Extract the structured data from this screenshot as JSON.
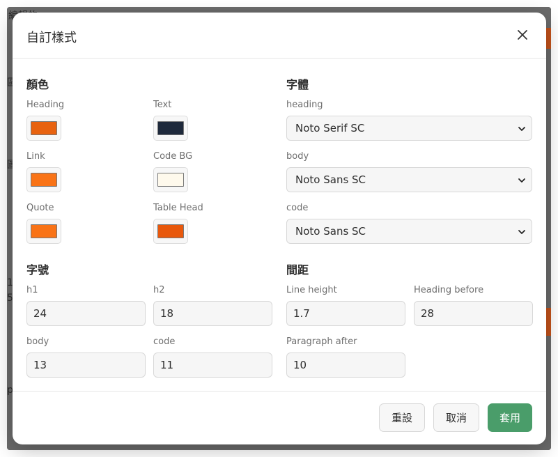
{
  "background": {
    "lines": [
      "編輯的",
      "區",
      "圖",
      "1",
      "5",
      "p"
    ]
  },
  "dialog": {
    "title": "自訂樣式",
    "close_icon": "close-icon"
  },
  "colors": {
    "title": "顏色",
    "fields": [
      {
        "label": "Heading",
        "color": "#E8620F"
      },
      {
        "label": "Text",
        "color": "#1E293B"
      },
      {
        "label": "Link",
        "color": "#F97316"
      },
      {
        "label": "Code BG",
        "color": "#FEF9EC"
      },
      {
        "label": "Quote",
        "color": "#F97316"
      },
      {
        "label": "Table Head",
        "color": "#E8580C"
      }
    ]
  },
  "fonts": {
    "title": "字體",
    "fields": [
      {
        "label": "heading",
        "value": "Noto Serif SC"
      },
      {
        "label": "body",
        "value": "Noto Sans SC"
      },
      {
        "label": "code",
        "value": "Noto Sans SC"
      }
    ]
  },
  "sizes": {
    "title": "字號",
    "fields": [
      {
        "label": "h1",
        "value": "24"
      },
      {
        "label": "h2",
        "value": "18"
      },
      {
        "label": "body",
        "value": "13"
      },
      {
        "label": "code",
        "value": "11"
      }
    ]
  },
  "spacing": {
    "title": "間距",
    "fields": [
      {
        "label": "Line height",
        "value": "1.7"
      },
      {
        "label": "Heading before",
        "value": "28"
      },
      {
        "label": "Paragraph after",
        "value": "10"
      }
    ]
  },
  "footer": {
    "reset_label": "重設",
    "cancel_label": "取消",
    "apply_label": "套用",
    "apply_color": "#4A9D6A"
  }
}
